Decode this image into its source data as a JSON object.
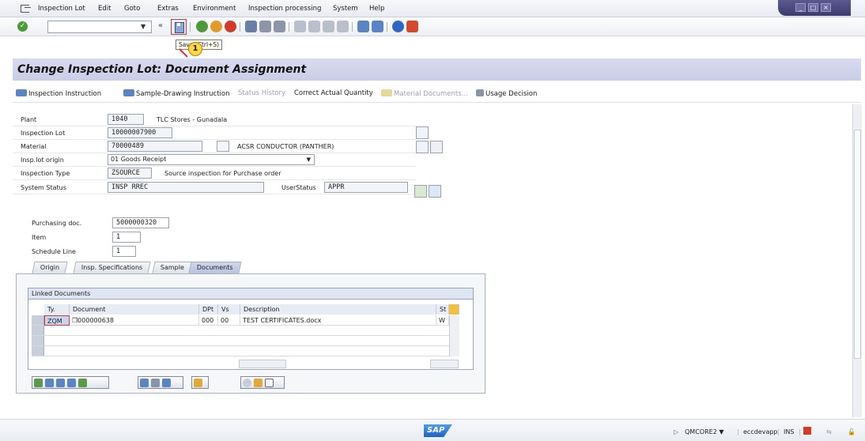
{
  "menubar": {
    "items": [
      {
        "label": "Inspection Lot",
        "u": "I"
      },
      {
        "label": "Edit",
        "u": "E"
      },
      {
        "label": "Goto",
        "u": "G"
      },
      {
        "label": "Extras",
        "u": "x"
      },
      {
        "label": "Environment",
        "u": "v"
      },
      {
        "label": "Inspection processing",
        "u": "I"
      },
      {
        "label": "System",
        "u": "S"
      },
      {
        "label": "Help",
        "u": "H"
      }
    ]
  },
  "toolbar": {
    "command_value": "",
    "tooltip": "Save (Ctrl+S)",
    "step": "1"
  },
  "title": "Change Inspection Lot: Document Assignment",
  "apptoolbar": {
    "inspection_instruction": "Inspection Instruction",
    "sample_drawing_instruction": "Sample-Drawing Instruction",
    "status_history": "Status History",
    "correct_actual_quantity": "Correct Actual Quantity",
    "material_documents": "Material Documents...",
    "usage_decision": "Usage Decision"
  },
  "form": {
    "plant_label": "Plant",
    "plant_value": "1040",
    "plant_text": "TLC Stores - Gunadala",
    "lot_label": "Inspection Lot",
    "lot_value": "10000007900",
    "material_label": "Material",
    "material_value": "70000489",
    "material_text": "ACSR CONDUCTOR (PANTHER)",
    "origin_label": "Insp.lot origin",
    "origin_value": "01 Goods Receipt",
    "type_label": "Inspection Type",
    "type_value": "ZSOURCE",
    "type_text": "Source inspection for Purchase order",
    "status_label": "System Status",
    "status_value": "INSP RREC",
    "userstatus_label": "UserStatus",
    "userstatus_value": "APPR",
    "po_label": "Purchasing doc.",
    "po_value": "5000000320",
    "item_label": "Item",
    "item_value": "1",
    "schedule_label": "Schedule Line",
    "schedule_value": "1"
  },
  "tabs": [
    {
      "label": "Origin"
    },
    {
      "label": "Insp. Specifications"
    },
    {
      "label": "Sample"
    },
    {
      "label": "Documents"
    }
  ],
  "linked_docs": {
    "title": "Linked Documents",
    "headers": {
      "ty": "Ty.",
      "document": "Document",
      "dpt": "DPt",
      "vs": "Vs",
      "description": "Description",
      "st": "St"
    },
    "rows": [
      {
        "ty": "ZQM",
        "document": "000000638",
        "dpt": "000",
        "vs": "00",
        "description": "TEST CERTIFICATES.docx",
        "st": "W"
      }
    ]
  },
  "statusbar": {
    "system": "QMCORE2",
    "server": "eccdevapp",
    "mode": "INS"
  },
  "colors": {
    "accent": "#c9cde6",
    "brand": "#1d62c7",
    "highlight": "#d93030"
  }
}
